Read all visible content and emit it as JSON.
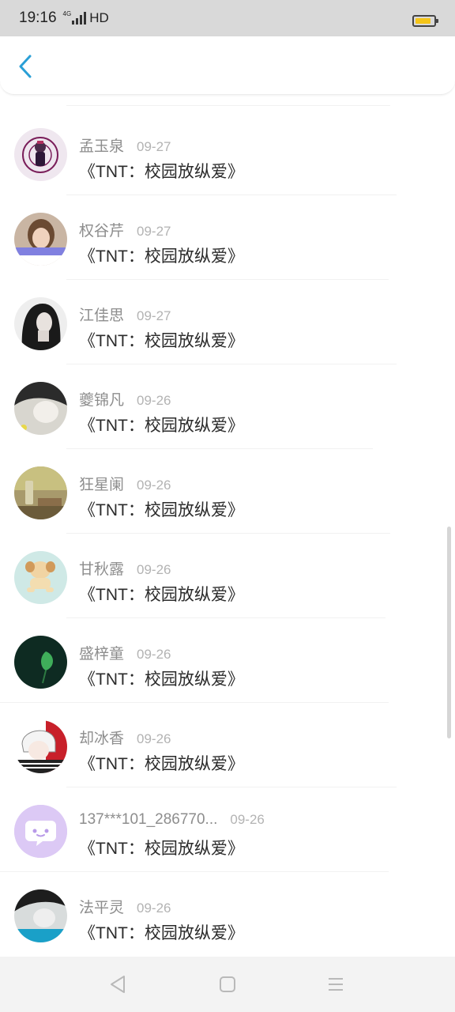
{
  "status_bar": {
    "time": "19:16",
    "network": "4G",
    "quality": "HD",
    "battery_level": 0.85,
    "battery_color": "#f5c518"
  },
  "header": {
    "back_icon": "chevron-left-icon",
    "accent_color": "#2a9fd6"
  },
  "list": {
    "items": [
      {
        "name": "孟玉泉",
        "date": "09-27",
        "title": "《TNT：校园放纵爱》"
      },
      {
        "name": "权谷芹",
        "date": "09-27",
        "title": "《TNT：校园放纵爱》"
      },
      {
        "name": "江佳思",
        "date": "09-27",
        "title": "《TNT：校园放纵爱》"
      },
      {
        "name": "夔锦凡",
        "date": "09-26",
        "title": "《TNT：校园放纵爱》"
      },
      {
        "name": "狂星阑",
        "date": "09-26",
        "title": "《TNT：校园放纵爱》"
      },
      {
        "name": "甘秋露",
        "date": "09-26",
        "title": "《TNT：校园放纵爱》"
      },
      {
        "name": "盛梓童",
        "date": "09-26",
        "title": "《TNT：校园放纵爱》"
      },
      {
        "name": "却冰香",
        "date": "09-26",
        "title": "《TNT：校园放纵爱》"
      },
      {
        "name": "137***101_286770...",
        "date": "09-26",
        "title": "《TNT：校园放纵爱》"
      },
      {
        "name": "法平灵",
        "date": "09-26",
        "title": "《TNT：校园放纵爱》"
      }
    ]
  },
  "nav_bar": {
    "back_icon": "triangle-back-icon",
    "home_icon": "square-home-icon",
    "menu_icon": "menu-lines-icon"
  }
}
